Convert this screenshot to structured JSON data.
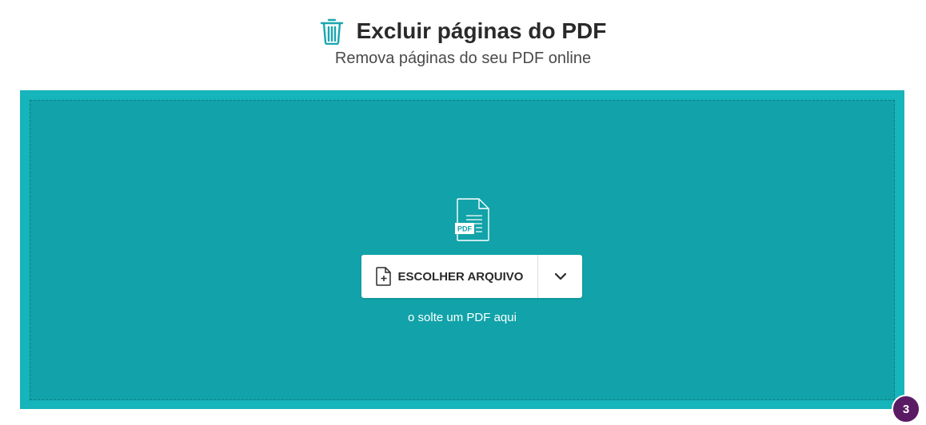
{
  "header": {
    "title": "Excluir páginas do PDF",
    "subtitle": "Remova páginas do seu PDF online",
    "icon": "trash-icon"
  },
  "upload": {
    "doc_icon": "pdf-file-icon",
    "doc_icon_label": "PDF",
    "choose_file_label": "ESCOLHER ARQUIVO",
    "choose_file_icon": "file-plus-icon",
    "dropdown_icon": "chevron-down-icon",
    "drop_hint": "o solte um PDF aqui"
  },
  "notification": {
    "count": "3"
  },
  "colors": {
    "accent": "#10a4ab",
    "accent_border": "#16b4bb",
    "icon_teal": "#1aa6b0",
    "badge": "#5b1a64"
  }
}
